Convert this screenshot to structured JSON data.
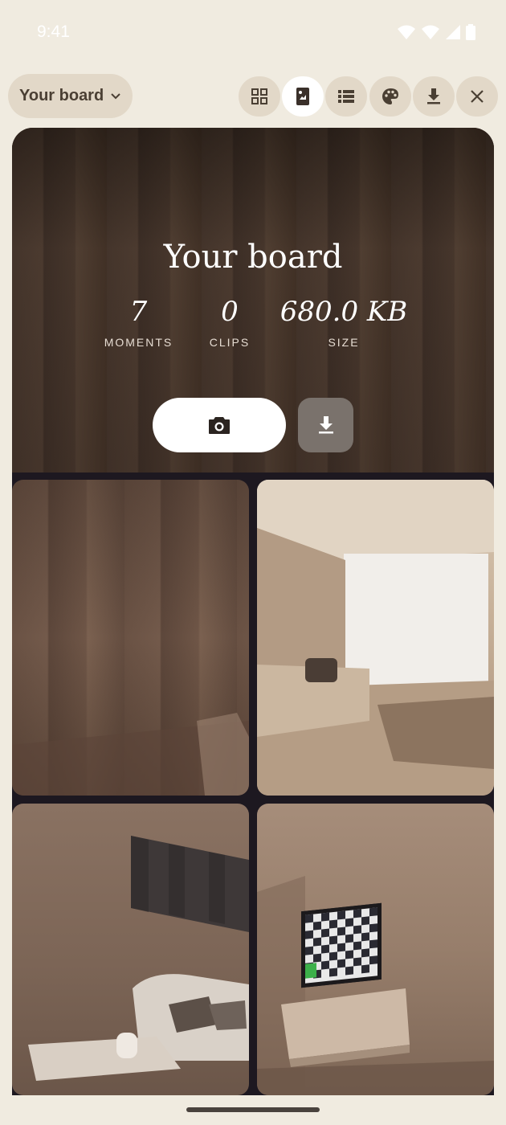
{
  "status_bar": {
    "time": "9:41",
    "icons": [
      "wifi-icon",
      "signal-icon",
      "signal-icon",
      "battery-icon"
    ]
  },
  "toolbar": {
    "board_selector_label": "Your board",
    "buttons": [
      {
        "name": "grid-view-icon",
        "active": false
      },
      {
        "name": "board-view-icon",
        "active": true
      },
      {
        "name": "list-view-icon",
        "active": false
      },
      {
        "name": "palette-icon",
        "active": false
      },
      {
        "name": "download-icon",
        "active": false
      },
      {
        "name": "close-icon",
        "active": false
      }
    ]
  },
  "board": {
    "title": "Your board",
    "stats": [
      {
        "value": "7",
        "label": "MOMENTS"
      },
      {
        "value": "0",
        "label": "CLIPS"
      },
      {
        "value": "680.0 KB",
        "label": "SIZE"
      }
    ],
    "camera_button_icon": "camera-icon",
    "download_button_icon": "download-icon"
  },
  "tiles": [
    {
      "description_icon": "wood-wall-photo"
    },
    {
      "description_icon": "living-room-photo"
    },
    {
      "description_icon": "sofa-corner-photo"
    },
    {
      "description_icon": "tv-room-photo"
    }
  ],
  "colors": {
    "background": "#f0ebe0",
    "chip": "#e2d8c8",
    "card_dark": "#1d1820",
    "active_button": "#ffffff"
  }
}
